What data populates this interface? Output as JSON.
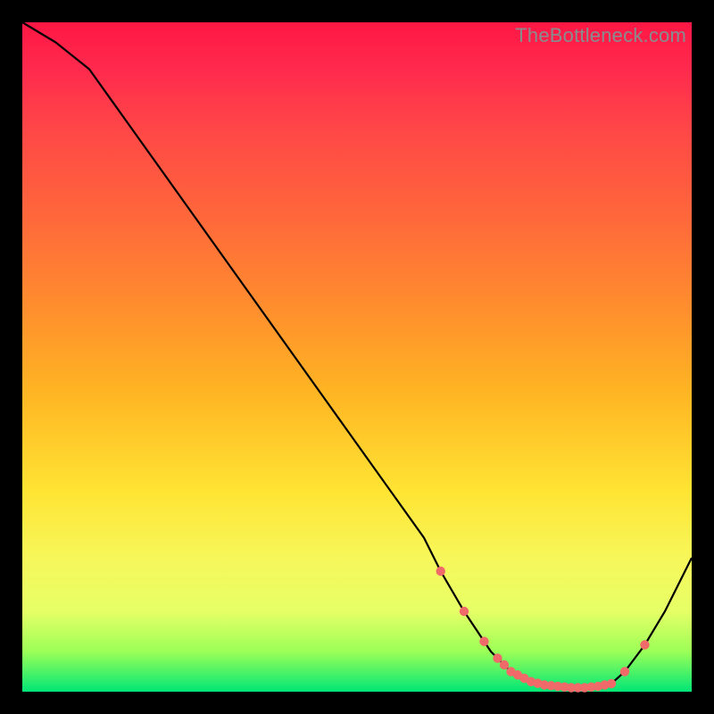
{
  "watermark": "TheBottleneck.com",
  "colors": {
    "line": "#000000",
    "marker": "#f06a6a",
    "marker_stroke": "#f06a6a"
  },
  "chart_data": {
    "type": "line",
    "title": "",
    "xlabel": "",
    "ylabel": "",
    "xlim": [
      0,
      100
    ],
    "ylim": [
      0,
      100
    ],
    "background": "rainbow-gradient-red-to-green",
    "series": [
      {
        "name": "main",
        "x": [
          0,
          5,
          10,
          15,
          20,
          25,
          30,
          35,
          40,
          45,
          50,
          55,
          60,
          62.5,
          66,
          70,
          73,
          76,
          78,
          80,
          82,
          84,
          86,
          88,
          90,
          93,
          96,
          100
        ],
        "y": [
          100,
          97,
          93,
          86,
          79,
          72,
          65,
          58,
          51,
          44,
          37,
          30,
          23,
          18,
          12,
          6,
          3,
          1.5,
          1.0,
          0.8,
          0.6,
          0.6,
          0.8,
          1.2,
          3,
          7,
          12,
          20
        ]
      }
    ],
    "markers": {
      "series": "main",
      "x": [
        62.5,
        66,
        69,
        71,
        72,
        73,
        74,
        75,
        76,
        77,
        78,
        79,
        80,
        81,
        82,
        83,
        84,
        85,
        86,
        87,
        88,
        90,
        93
      ]
    }
  }
}
